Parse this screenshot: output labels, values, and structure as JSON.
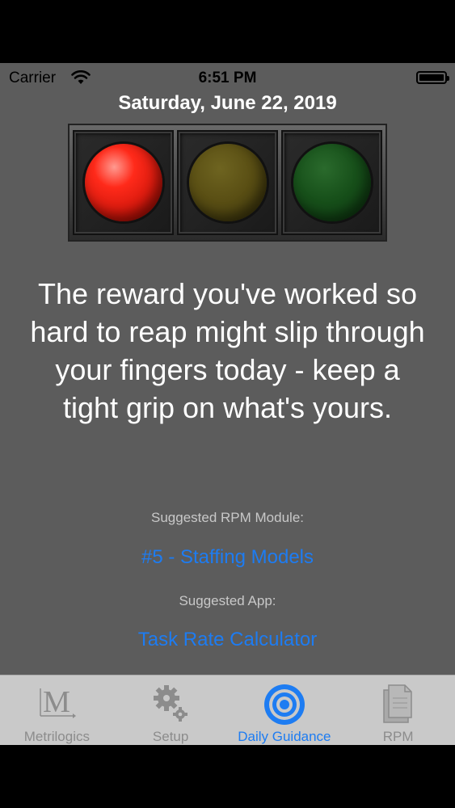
{
  "status_bar": {
    "carrier": "Carrier",
    "time": "6:51 PM"
  },
  "date": "Saturday, June 22, 2019",
  "traffic_light": {
    "active_lamp": "red",
    "lamps": [
      "red",
      "yellow",
      "green"
    ]
  },
  "message": "The reward you've worked so hard to reap might slip through your fingers today - keep a tight grip on what's yours.",
  "suggested_module": {
    "label": "Suggested RPM Module:",
    "link": "#5 - Staffing Models"
  },
  "suggested_app": {
    "label": "Suggested App:",
    "link": "Task Rate Calculator"
  },
  "tabs": [
    {
      "label": "Metrilogics",
      "icon": "metrilogics-logo-icon",
      "active": false
    },
    {
      "label": "Setup",
      "icon": "gears-icon",
      "active": false
    },
    {
      "label": "Daily Guidance",
      "icon": "target-icon",
      "active": true
    },
    {
      "label": "RPM",
      "icon": "documents-icon",
      "active": false
    }
  ],
  "colors": {
    "background": "#5c5c5c",
    "accent": "#1d7cf2",
    "tab_bar": "#c9c9c9"
  }
}
